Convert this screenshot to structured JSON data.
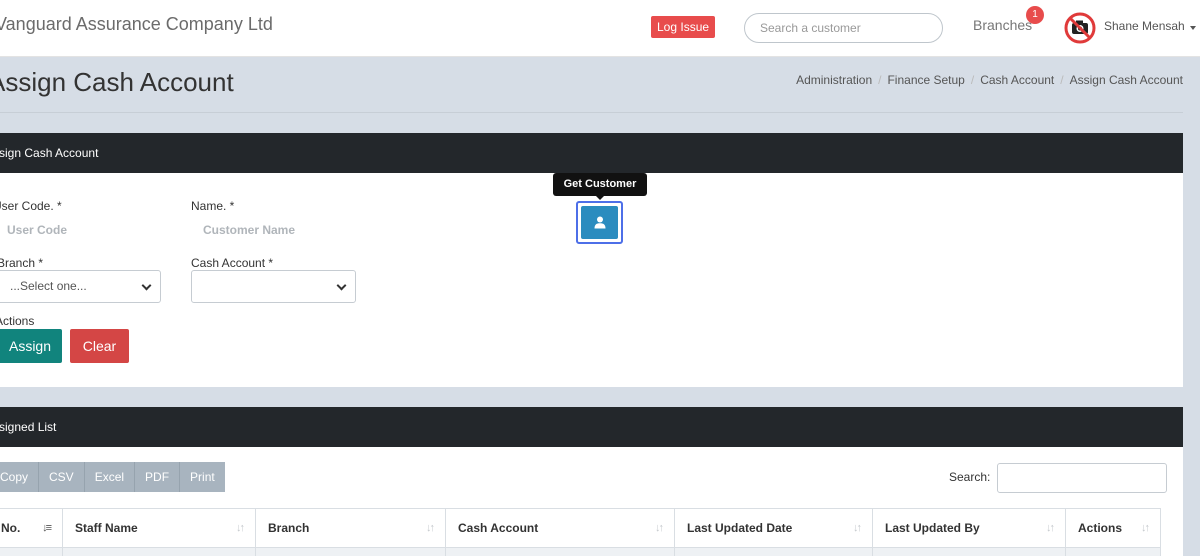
{
  "header": {
    "company": "Vanguard Assurance Company Ltd",
    "log_issue": "Log Issue",
    "search_placeholder": "Search a customer",
    "branches": "Branches",
    "branches_count": "1",
    "user_name": "Shane Mensah"
  },
  "page": {
    "title": "Assign Cash Account",
    "breadcrumb": [
      "Administration",
      "Finance Setup",
      "Cash Account",
      "Assign Cash Account"
    ]
  },
  "assign_card": {
    "title": "Assign Cash Account",
    "user_code_label": "User Code. *",
    "user_code_placeholder": "User Code",
    "name_label": "Name. *",
    "name_placeholder": "Customer Name",
    "branch_label": "Branch *",
    "branch_selected": "...Select one...",
    "cash_account_label": "Cash Account *",
    "cash_account_selected": "",
    "actions_label": "Actions",
    "assign_button": "Assign",
    "clear_button": "Clear",
    "tooltip": "Get Customer"
  },
  "list_card": {
    "title": "Assigned List",
    "export_buttons": [
      "Copy",
      "CSV",
      "Excel",
      "PDF",
      "Print"
    ],
    "search_label": "Search:",
    "columns": [
      "No.",
      "Staff Name",
      "Branch",
      "Cash Account",
      "Last Updated Date",
      "Last Updated By",
      "Actions"
    ]
  },
  "colors": {
    "header_dark": "#23272b",
    "assign": "#11847d",
    "clear": "#d44645",
    "primary": "#2b8cbf",
    "danger": "#e84c4c"
  }
}
